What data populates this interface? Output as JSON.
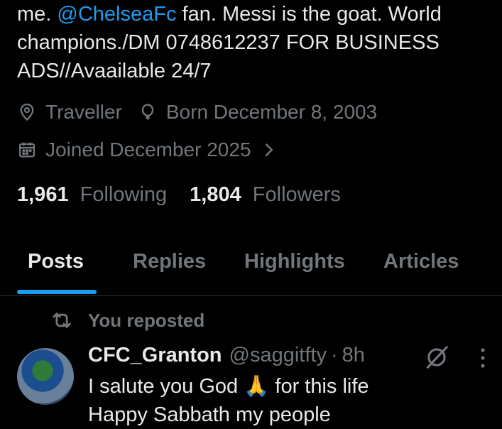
{
  "bio": {
    "line1_prefix": "me. ",
    "line1_mention": "@ChelseaFc",
    "line1_suffix": " fan. Messi is the goat. World",
    "line2": "champions./DM 0748612237 FOR BUSINESS",
    "line3": "ADS//Avaailable 24/7"
  },
  "meta": {
    "location": "Traveller",
    "birthday": "Born December 8, 2003",
    "joined": "Joined December 2025"
  },
  "stats": {
    "following_count": "1,961",
    "following_label": "Following",
    "followers_count": "1,804",
    "followers_label": "Followers"
  },
  "tabs": [
    {
      "label": "Posts",
      "active": true
    },
    {
      "label": "Replies",
      "active": false
    },
    {
      "label": "Highlights",
      "active": false
    },
    {
      "label": "Articles",
      "active": false
    }
  ],
  "post": {
    "repost_label": "You reposted",
    "display_name": "CFC_Granton",
    "handle": "@saggitfty",
    "separator": "·",
    "time": "8h",
    "text_line1": "I salute you God 🙏 for this life",
    "text_line2": "Happy Sabbath my people"
  },
  "colors": {
    "accent": "#1d9bf0",
    "muted": "#71767b",
    "text": "#e7e9ea",
    "background": "#000000"
  }
}
